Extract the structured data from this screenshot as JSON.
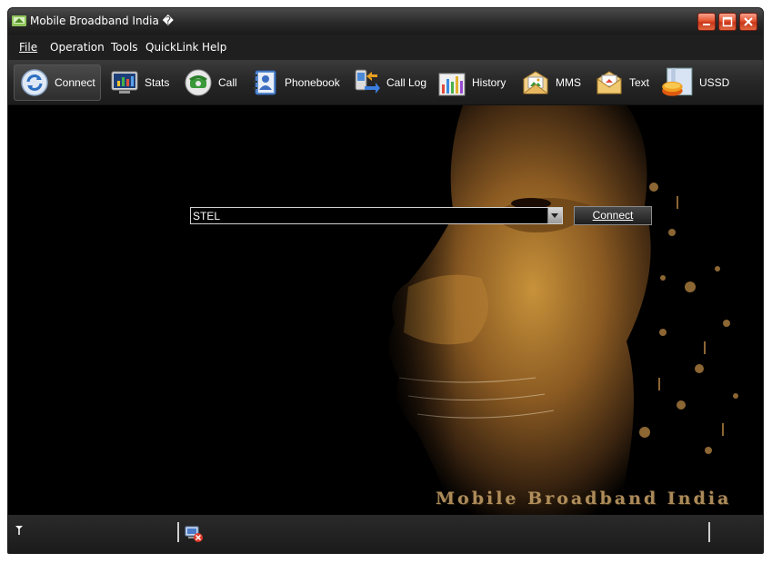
{
  "window": {
    "title": "Mobile Broadband India �"
  },
  "menu": {
    "items": [
      {
        "label": "File",
        "underline": "F"
      },
      {
        "label": "Operation",
        "underline": "O"
      },
      {
        "label": "Tools",
        "underline": "T"
      },
      {
        "label": "QuickLink",
        "underline": ""
      },
      {
        "label": "Help",
        "underline": "H"
      }
    ]
  },
  "toolbar": {
    "items": [
      {
        "label": "Connect",
        "icon": "connect-icon",
        "active": true
      },
      {
        "label": "Stats",
        "icon": "stats-icon"
      },
      {
        "label": "Call",
        "icon": "call-icon"
      },
      {
        "label": "Phonebook",
        "icon": "phonebook-icon"
      },
      {
        "label": "Call Log",
        "icon": "call-log-icon"
      },
      {
        "label": "History",
        "icon": "history-icon"
      },
      {
        "label": "MMS",
        "icon": "mms-icon"
      },
      {
        "label": "Text",
        "icon": "text-icon"
      },
      {
        "label": "USSD",
        "icon": "ussd-icon"
      }
    ]
  },
  "main": {
    "profile_select_value": "STEL",
    "connect_button_label": "Connect",
    "watermark": "Mobile Broadband India"
  },
  "status": {
    "signal_icon": "signal-icon",
    "connection_icon": "disconnected-icon"
  },
  "colors": {
    "background": "#000000",
    "chrome": "#2b2b2b",
    "close_button": "#e4552f",
    "watermark": "#c9a36a"
  }
}
